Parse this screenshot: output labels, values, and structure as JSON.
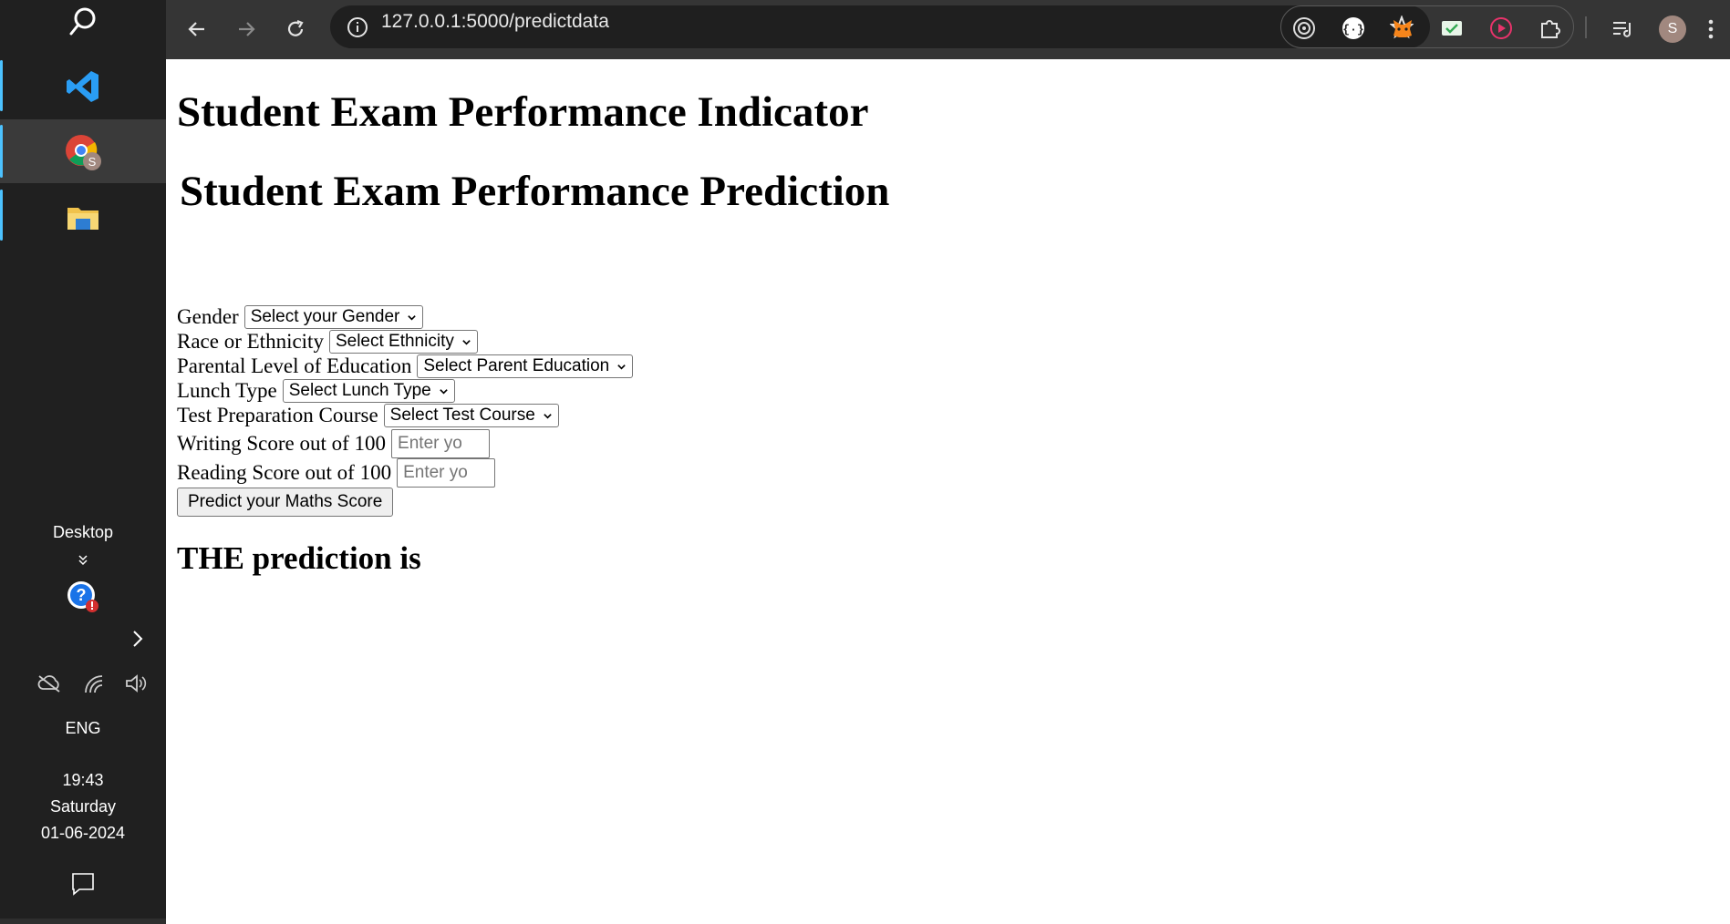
{
  "taskbar": {
    "desktop_label": "Desktop",
    "language": "ENG",
    "time": "19:43",
    "day": "Saturday",
    "date": "01-06-2024",
    "avatar_letter": "S",
    "icons": [
      "search-icon",
      "vscode-icon",
      "chrome-icon",
      "file-explorer-icon",
      "help-icon",
      "chevron-right-icon",
      "cloud-off-icon",
      "wifi-icon",
      "volume-icon",
      "notification-icon"
    ]
  },
  "browser": {
    "url": "127.0.0.1:5000/predictdata",
    "profile_letter": "S",
    "extensions": [
      "target-extension-icon",
      "code-extension-icon",
      "metamask-icon",
      "check-mail-icon",
      "record-icon",
      "puzzle-extensions-icon"
    ]
  },
  "page": {
    "title": "Student Exam Performance Indicator",
    "subtitle": "Student Exam Performance Prediction",
    "form": {
      "gender_label": "Gender",
      "gender_value": "Select your Gender",
      "ethnicity_label": "Race or Ethnicity",
      "ethnicity_value": "Select Ethnicity",
      "parent_edu_label": "Parental Level of Education",
      "parent_edu_value": "Select Parent Education",
      "lunch_label": "Lunch Type",
      "lunch_value": "Select Lunch Type",
      "test_prep_label": "Test Preparation Course",
      "test_prep_value": "Select Test Course",
      "writing_label": "Writing Score out of 100",
      "writing_placeholder": "Enter yo",
      "reading_label": "Reading Score out of 100",
      "reading_placeholder": "Enter yo",
      "submit_label": "Predict your Maths Score"
    },
    "result_heading": "THE prediction is"
  }
}
